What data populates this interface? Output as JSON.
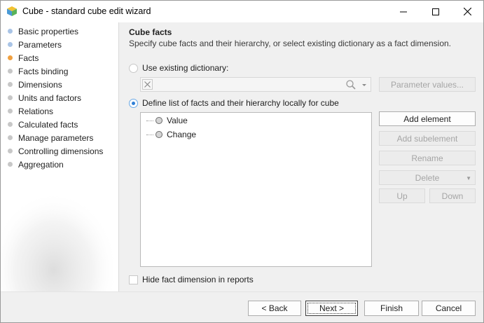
{
  "window": {
    "title": "Cube - standard cube edit wizard",
    "icon": "cube-icon"
  },
  "nav": {
    "items": [
      {
        "label": "Basic properties",
        "color": "#a9c4e6"
      },
      {
        "label": "Parameters",
        "color": "#a9c4e6"
      },
      {
        "label": "Facts",
        "color": "#f0a040"
      },
      {
        "label": "Facts binding",
        "color": "#c7c7c7"
      },
      {
        "label": "Dimensions",
        "color": "#c7c7c7"
      },
      {
        "label": "Units and factors",
        "color": "#c7c7c7"
      },
      {
        "label": "Relations",
        "color": "#c7c7c7"
      },
      {
        "label": "Calculated facts",
        "color": "#c7c7c7"
      },
      {
        "label": "Manage parameters",
        "color": "#c7c7c7"
      },
      {
        "label": "Controlling dimensions",
        "color": "#c7c7c7"
      },
      {
        "label": "Aggregation",
        "color": "#c7c7c7"
      }
    ],
    "active_index": 2
  },
  "content": {
    "title": "Cube facts",
    "description": "Specify cube facts and their hierarchy, or select existing dictionary as a fact dimension.",
    "use_existing": {
      "label": "Use existing dictionary:",
      "checked": false,
      "combo_value": "",
      "param_button": "Parameter values..."
    },
    "define_local": {
      "label": "Define list of facts and their hierarchy locally for cube",
      "checked": true
    },
    "tree": {
      "items": [
        "Value",
        "Change"
      ]
    },
    "buttons": {
      "add_element": "Add element",
      "add_subelement": "Add subelement",
      "rename": "Rename",
      "delete": "Delete",
      "up": "Up",
      "down": "Down"
    },
    "hide_fact": {
      "label": "Hide fact dimension in reports",
      "checked": false
    }
  },
  "footer": {
    "back": "< Back",
    "next": "Next >",
    "finish": "Finish",
    "cancel": "Cancel"
  }
}
